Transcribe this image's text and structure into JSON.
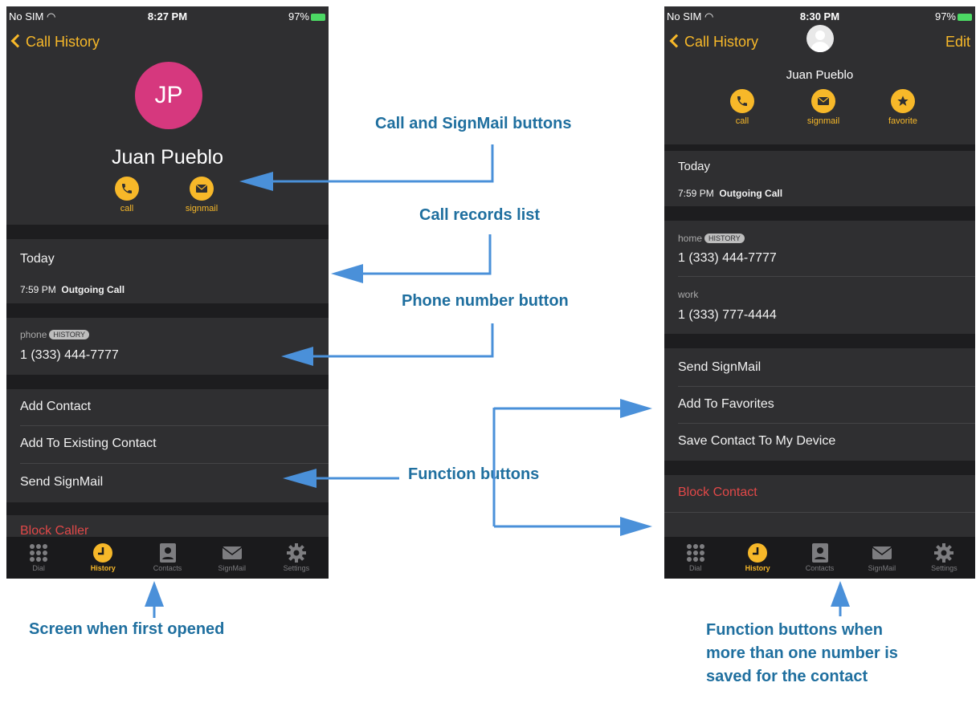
{
  "left_screen": {
    "status": {
      "carrier": "No SIM",
      "time": "8:27 PM",
      "battery": "97%"
    },
    "nav": {
      "back_label": "Call History"
    },
    "avatar_initials": "JP",
    "contact_name": "Juan Pueblo",
    "actions": [
      {
        "label": "call",
        "icon": "phone-icon"
      },
      {
        "label": "signmail",
        "icon": "envelope-icon"
      }
    ],
    "history": {
      "section": "Today",
      "time": "7:59 PM",
      "type": "Outgoing Call"
    },
    "phone": {
      "label": "phone",
      "badge": "HISTORY",
      "number": "1 (333) 444-7777"
    },
    "functions": [
      "Add Contact",
      "Add To Existing Contact",
      "Send SignMail"
    ],
    "block_label": "Block Caller"
  },
  "right_screen": {
    "status": {
      "carrier": "No SIM",
      "time": "8:30 PM",
      "battery": "97%"
    },
    "nav": {
      "back_label": "Call History",
      "edit_label": "Edit"
    },
    "contact_name": "Juan Pueblo",
    "actions": [
      {
        "label": "call",
        "icon": "phone-icon"
      },
      {
        "label": "signmail",
        "icon": "envelope-icon"
      },
      {
        "label": "favorite",
        "icon": "star-icon"
      }
    ],
    "history": {
      "section": "Today",
      "time": "7:59 PM",
      "type": "Outgoing Call"
    },
    "numbers": [
      {
        "label": "home",
        "badge": "HISTORY",
        "number": "1 (333) 444-7777"
      },
      {
        "label": "work",
        "number": "1 (333) 777-4444"
      }
    ],
    "functions": [
      "Send SignMail",
      "Add To Favorites",
      "Save Contact To My Device"
    ],
    "block_label": "Block Contact"
  },
  "tabbar": [
    {
      "label": "Dial",
      "icon": "keypad-icon"
    },
    {
      "label": "History",
      "icon": "clock-icon"
    },
    {
      "label": "Contacts",
      "icon": "contacts-icon"
    },
    {
      "label": "SignMail",
      "icon": "envelope-icon"
    },
    {
      "label": "Settings",
      "icon": "gear-icon"
    }
  ],
  "active_tab": "History",
  "callouts": {
    "call_signmail": "Call and SignMail buttons",
    "call_records": "Call records list",
    "phone_number": "Phone number button",
    "function_buttons": "Function buttons",
    "first_opened": "Screen when first opened",
    "multi_number": [
      "Function buttons when",
      "more than one number is",
      "saved for the contact"
    ]
  },
  "colors": {
    "accent": "#f7b829",
    "avatar": "#d6387e",
    "destructive": "#e04848",
    "callout": "#1f6f9f",
    "arrow": "#4a90d9"
  }
}
